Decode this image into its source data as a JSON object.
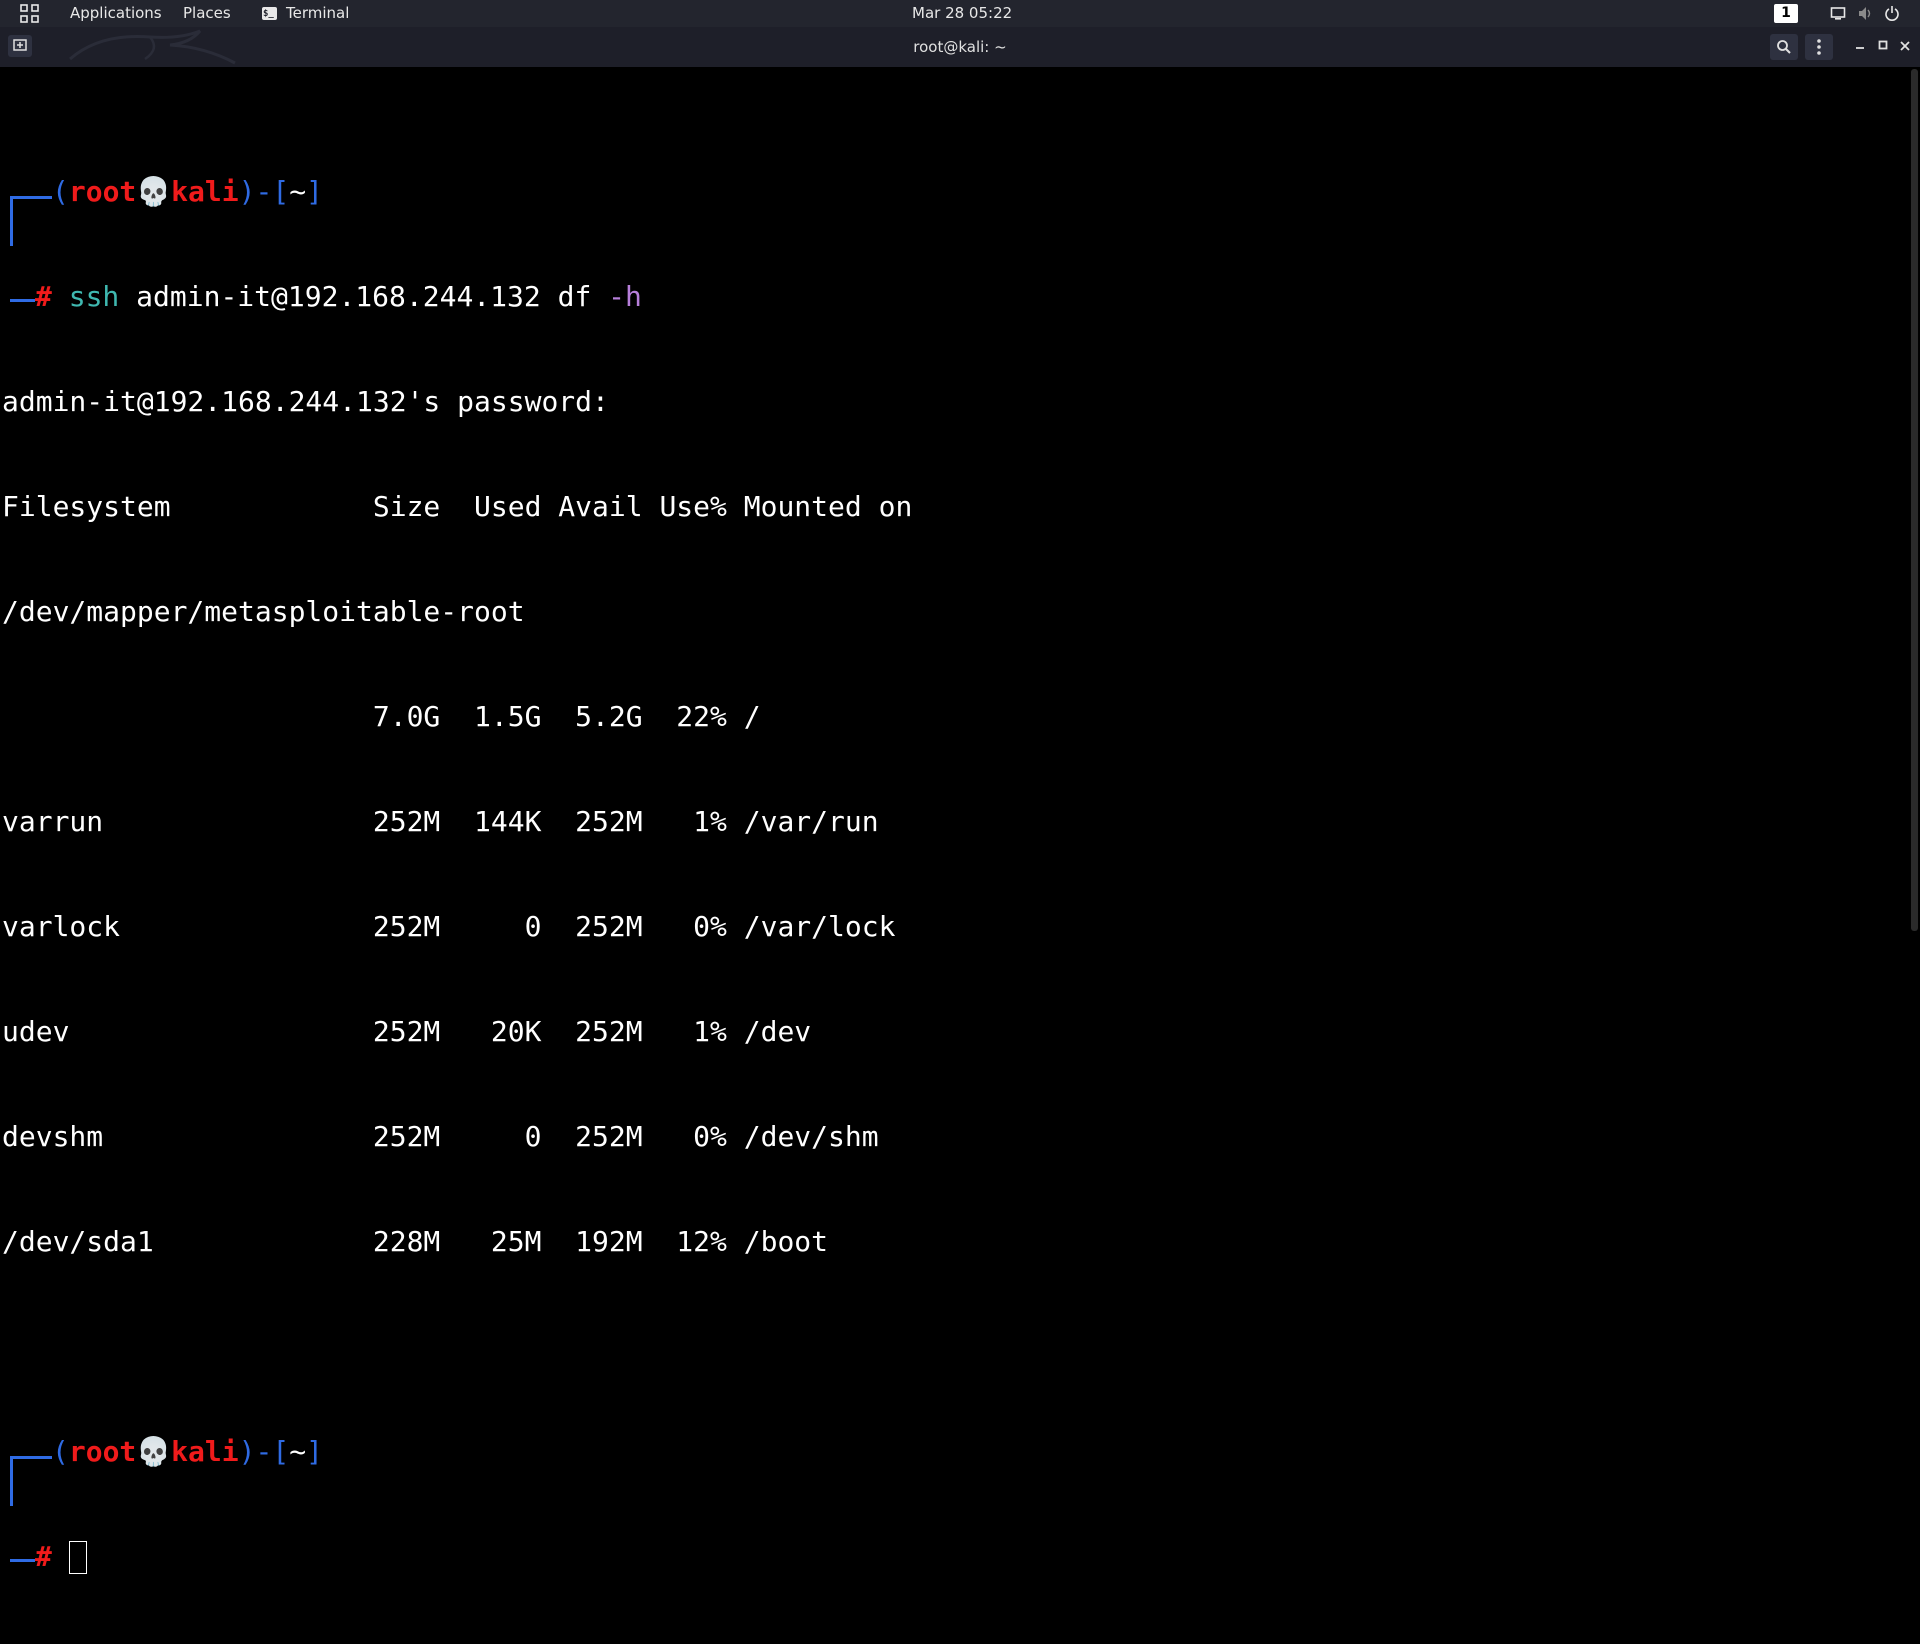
{
  "top_panel": {
    "applications": "Applications",
    "places": "Places",
    "terminal_task": "Terminal",
    "clock": "Mar 28  05:22",
    "workspace": "1"
  },
  "window": {
    "title": "root@kali: ~"
  },
  "terminal": {
    "prompt1": {
      "open": "(",
      "user": "root",
      "skull": "💀",
      "host": "kali",
      "close": ")-[",
      "dir": "~",
      "end": "]",
      "hash": "#",
      "cmd_ssh": "ssh",
      "cmd_args": " admin-it@192.168.244.132 df ",
      "cmd_flag": "-h"
    },
    "output": [
      "admin-it@192.168.244.132's password:",
      "Filesystem            Size  Used Avail Use% Mounted on",
      "/dev/mapper/metasploitable-root",
      "                      7.0G  1.5G  5.2G  22% /",
      "varrun                252M  144K  252M   1% /var/run",
      "varlock               252M     0  252M   0% /var/lock",
      "udev                  252M   20K  252M   1% /dev",
      "devshm                252M     0  252M   0% /dev/shm",
      "/dev/sda1             228M   25M  192M  12% /boot"
    ],
    "prompt2": {
      "open": "(",
      "user": "root",
      "skull": "💀",
      "host": "kali",
      "close": ")-[",
      "dir": "~",
      "end": "]",
      "hash": "#"
    }
  },
  "colors": {
    "prompt_blue": "#2f6be4",
    "prompt_red": "#f01b1b",
    "command_cyan": "#3fb8b0",
    "flag_magenta": "#b77fdb",
    "panel_bg": "#23252e",
    "terminal_bg": "#000000"
  },
  "icons": [
    "app-grid-icon",
    "terminal-icon",
    "display-icon",
    "volume-icon",
    "power-icon",
    "new-tab-icon",
    "search-icon",
    "menu-icon",
    "minimize-icon",
    "maximize-icon",
    "close-icon"
  ]
}
